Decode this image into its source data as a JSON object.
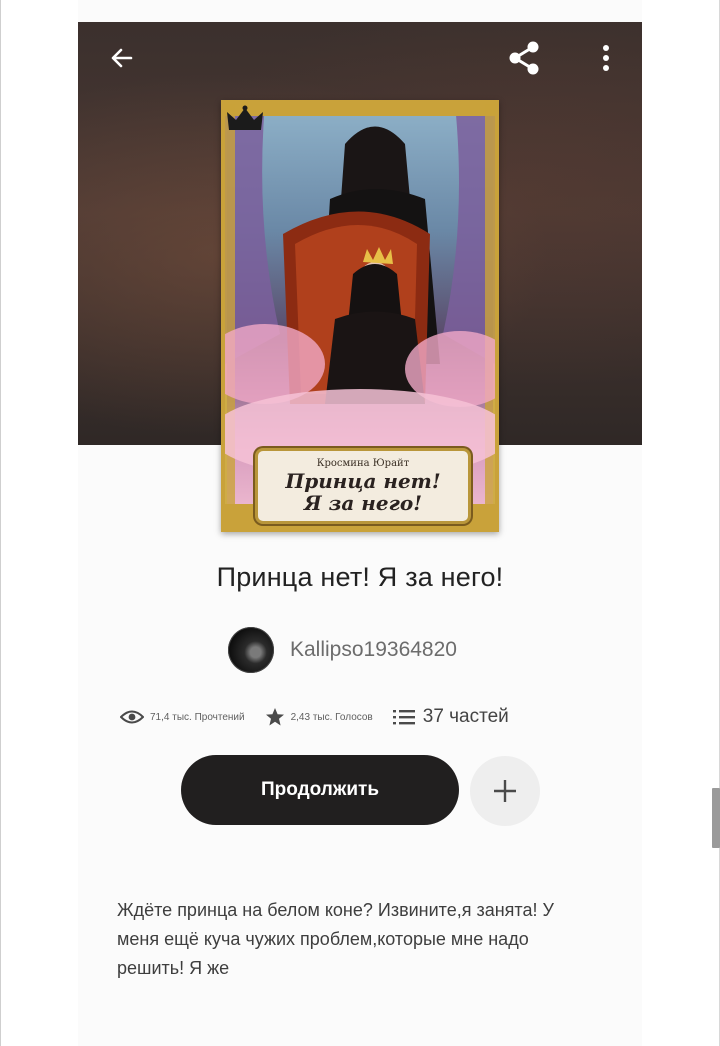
{
  "header": {
    "back_icon": "arrow-left-icon",
    "share_icon": "share-icon",
    "more_icon": "vertical-dots-icon"
  },
  "cover": {
    "author_text": "Кросмина Юрайт",
    "title_line1": "Принца нет!",
    "title_line2": "Я за него!"
  },
  "story": {
    "title": "Принца нет! Я за него!",
    "author": "Kallipso19364820"
  },
  "stats": {
    "reads": "71,4 тыс. Прочтений",
    "votes": "2,43 тыс. Голосов",
    "parts": "37 частей"
  },
  "actions": {
    "continue_label": "Продолжить",
    "add_icon": "plus-icon"
  },
  "description": {
    "text": "Ждёте принца на белом коне? Извините,я занята! У меня ещё куча чужих проблем,которые мне надо решить! Я же"
  },
  "colors": {
    "accent_dark": "#211f1f",
    "header_bg": "#3b302d"
  }
}
